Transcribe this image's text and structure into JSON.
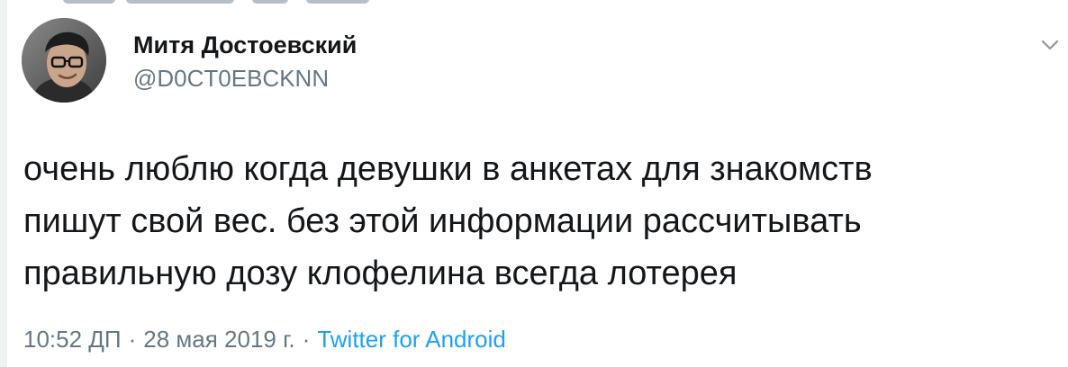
{
  "tweet": {
    "author": {
      "display_name": "Митя Достоевский",
      "handle": "@D0CT0EBCKNN"
    },
    "text_lines": [
      "очень люблю когда девушки в анкетах для знакомств",
      "пишут свой вес. без этой информации рассчитывать",
      "правильную дозу клофелина всегда лотерея"
    ],
    "time": "10:52 ДП",
    "date": "28 мая 2019 г.",
    "separator": "·",
    "source": "Twitter for Android",
    "menu_icon": "chevron-down-icon"
  },
  "colors": {
    "primary_text": "#14171a",
    "secondary_text": "#657786",
    "link": "#1da1f2",
    "background": "#ffffff"
  }
}
